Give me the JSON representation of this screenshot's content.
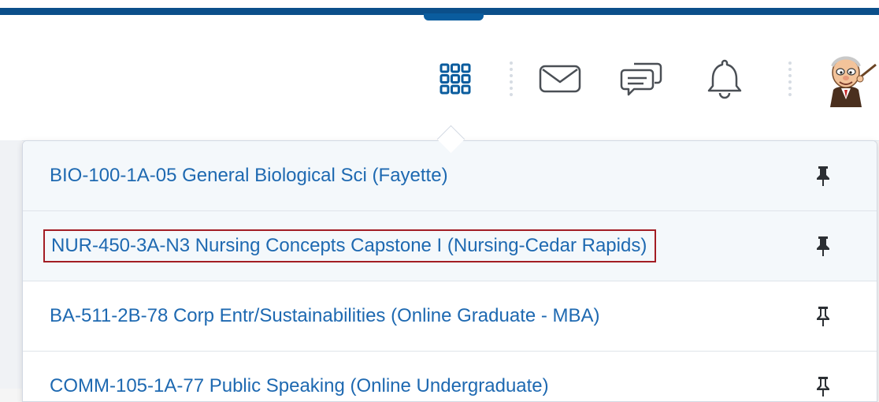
{
  "header": {
    "nav_icons": [
      {
        "name": "apps-grid-icon",
        "label": "Course Selector"
      },
      {
        "name": "mail-icon",
        "label": "Message alerts"
      },
      {
        "name": "chat-icon",
        "label": "Subscription alerts"
      },
      {
        "name": "bell-icon",
        "label": "Update alerts"
      }
    ],
    "accent_color": "#0b4f8a",
    "icon_color": "#0a5c9e"
  },
  "course_selector": {
    "items": [
      {
        "title": "BIO-100-1A-05 General Biological Sci (Fayette)",
        "pinned": true
      },
      {
        "title": "NUR-450-3A-N3 Nursing Concepts Capstone I (Nursing-Cedar Rapids)",
        "pinned": true,
        "highlighted": true
      },
      {
        "title": "BA-511-2B-78 Corp Entr/Sustainabilities (Online Graduate - MBA)",
        "pinned": false
      },
      {
        "title": "COMM-105-1A-77 Public Speaking (Online Undergraduate)",
        "pinned": false
      }
    ],
    "link_color": "#1e69b1",
    "highlight_border_color": "#a31d24"
  }
}
